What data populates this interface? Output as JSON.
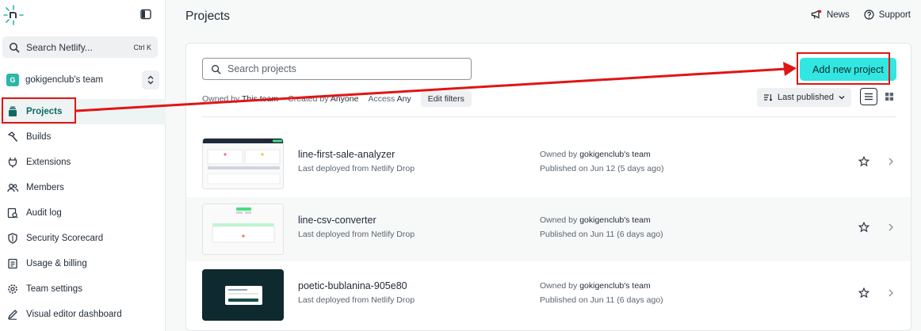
{
  "sidebar": {
    "search_label": "Search Netlify...",
    "search_shortcut": "Ctrl K",
    "team_initial": "G",
    "team_name": "gokigenclub's team",
    "nav": [
      {
        "label": "Projects",
        "icon": "layers-icon"
      },
      {
        "label": "Builds",
        "icon": "hammer-icon"
      },
      {
        "label": "Extensions",
        "icon": "plug-icon"
      },
      {
        "label": "Members",
        "icon": "users-icon"
      },
      {
        "label": "Audit log",
        "icon": "audit-icon"
      },
      {
        "label": "Security Scorecard",
        "icon": "shield-icon"
      },
      {
        "label": "Usage & billing",
        "icon": "billing-icon"
      },
      {
        "label": "Team settings",
        "icon": "gear-icon"
      },
      {
        "label": "Visual editor dashboard",
        "icon": "pen-icon"
      }
    ]
  },
  "header": {
    "title": "Projects",
    "news": "News",
    "support": "Support"
  },
  "toolbar": {
    "search_placeholder": "Search projects",
    "add_button": "Add new project",
    "owned_by_label": "Owned by",
    "owned_by_value": "This team",
    "created_by_label": "Created by",
    "created_by_value": "Anyone",
    "access_label": "Access",
    "access_value": "Any",
    "edit_filters": "Edit filters",
    "sort_label": "Last published"
  },
  "projects": [
    {
      "name": "line-first-sale-analyzer",
      "deploy": "Last deployed from Netlify Drop",
      "owner_prefix": "Owned by",
      "owner": "gokigenclub's team",
      "published": "Published on Jun 12 (5 days ago)"
    },
    {
      "name": "line-csv-converter",
      "deploy": "Last deployed from Netlify Drop",
      "owner_prefix": "Owned by",
      "owner": "gokigenclub's team",
      "published": "Published on Jun 11 (6 days ago)"
    },
    {
      "name": "poetic-bublanina-905e80",
      "deploy": "Last deployed from Netlify Drop",
      "owner_prefix": "Owned by",
      "owner": "gokigenclub's team",
      "published": "Published on Jun 11 (6 days ago)"
    }
  ],
  "colors": {
    "accent": "#32e6e2",
    "brand": "#2bb7a7",
    "annotation": "#e01515"
  }
}
